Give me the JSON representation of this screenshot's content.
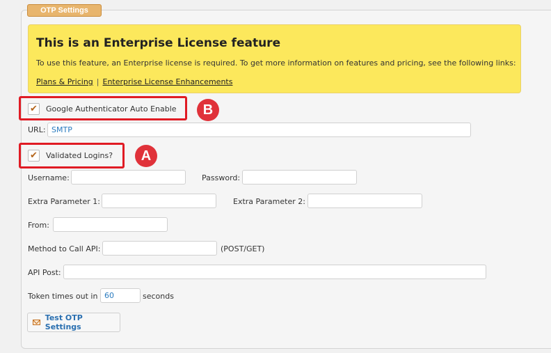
{
  "section": {
    "tab_label": "OTP Settings"
  },
  "notice": {
    "title": "This is an Enterprise License feature",
    "body": "To use this feature, an Enterprise license is required. To get more information on features and pricing, see the following links:",
    "link1": "Plans & Pricing",
    "separator": "|",
    "link2": "Enterprise License Enhancements"
  },
  "google_auth": {
    "label": "Google Authenticator Auto Enable",
    "checked": true
  },
  "url": {
    "label": "URL:",
    "value": "SMTP"
  },
  "validated_logins": {
    "label": "Validated Logins?",
    "checked": true
  },
  "username": {
    "label": "Username:",
    "value": ""
  },
  "password": {
    "label": "Password:",
    "value": ""
  },
  "extra1": {
    "label": "Extra Parameter 1:",
    "value": ""
  },
  "extra2": {
    "label": "Extra Parameter 2:",
    "value": ""
  },
  "from": {
    "label": "From:",
    "value": ""
  },
  "method": {
    "label": "Method to Call API:",
    "value": "",
    "hint": "(POST/GET)"
  },
  "api_post": {
    "label": "API Post:",
    "value": ""
  },
  "token": {
    "label_before": "Token times out in",
    "value": "60",
    "label_after": "seconds"
  },
  "test_button": {
    "label": "Test OTP Settings"
  },
  "annotations": {
    "badge_b": "B",
    "badge_a": "A",
    "highlight_color": "#e01b24"
  },
  "colors": {
    "notice_bg": "#fce85c",
    "tab_bg": "#e8b56d",
    "check_color": "#b4651b",
    "link_blue": "#2a6fb0"
  }
}
